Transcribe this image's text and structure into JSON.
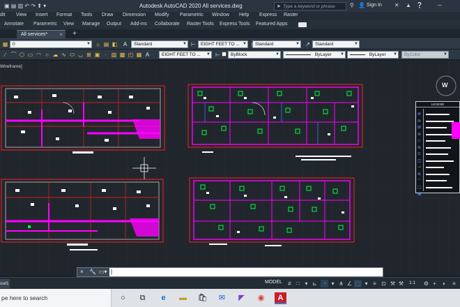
{
  "titlebar": {
    "title": "Autodesk AutoCAD 2020   All services.dwg",
    "search_placeholder": "Type a keyword or phrase",
    "signin": "Sign In"
  },
  "menu": [
    "dit",
    "View",
    "Insert",
    "Format",
    "Tools",
    "Draw",
    "Dimension",
    "Modify",
    "Parametric",
    "Window",
    "Help",
    "Express",
    "Raster"
  ],
  "ribbon_tabs": [
    "Annotate",
    "Parametric",
    "View",
    "Manage",
    "Output",
    "Add-ins",
    "Collaborate",
    "Raster Tools",
    "Express Tools",
    "Featured Apps"
  ],
  "document_tab": {
    "label": "All services*"
  },
  "toolbar1": {
    "layer_value": "0",
    "textstyle": "Standard",
    "dimstyle": "EIGHT FEET TO ...",
    "tablestyle": "Standard",
    "mleaderstyle": "Standard"
  },
  "toolbar2": {
    "dimstyle2": "EIGHT FEET TO ...",
    "color": "ByBlock",
    "linetype": "ByLayer",
    "lineweight": "ByLayer",
    "plotstyle": "ByColor"
  },
  "viewport_label": "Wireframe]",
  "legend": {
    "title": "LEGEND"
  },
  "compass": {
    "letter": "W"
  },
  "statusbar": {
    "layout_tab": "out1",
    "model": "MODEL",
    "scale": "1:1"
  },
  "taskbar": {
    "search_placeholder": "pe here to search"
  },
  "colors": {
    "accent": "#4aa3ff",
    "magenta": "#ff00ff",
    "green": "#00ff40",
    "red": "#ff2020",
    "canvas": "#21262d"
  }
}
